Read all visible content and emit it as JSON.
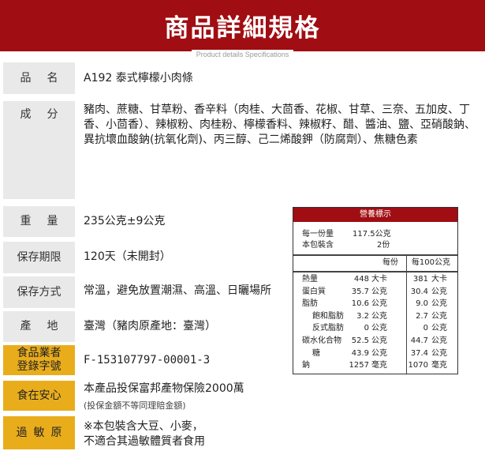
{
  "header": {
    "title": "商品詳細規格",
    "subtitle": "Product details Specifications"
  },
  "specs": {
    "name": {
      "label": "品名",
      "value": "A192 泰式檸檬小肉條"
    },
    "ingredients": {
      "label": "成分",
      "lines": [
        "豬肉、蔗糖、甘草粉、香辛料（肉桂、大茴香、花椒、甘草、三奈、五加皮、丁",
        "香、小茴香）、辣椒粉、肉桂粉、檸檬香料、辣椒籽、醋、醬油、鹽、亞硝酸鈉、",
        "異抗壞血酸鈉(抗氧化劑)、丙三醇、己二烯酸鉀（防腐劑）、焦糖色素"
      ]
    },
    "weight": {
      "label": "重量",
      "value": "235公克±9公克"
    },
    "shelf_life": {
      "label": "保存期限",
      "value": "120天（未開封）"
    },
    "storage": {
      "label": "保存方式",
      "value": "常溫，避免放置潮濕、高溫、日曬場所"
    },
    "origin": {
      "label": "產地",
      "value": "臺灣（豬肉原產地：臺灣）"
    },
    "registration": {
      "label_line1": "食品業者",
      "label_line2": "登錄字號",
      "value": "F-153107797-00001-3"
    },
    "insurance": {
      "label": "食在安心",
      "value": "本產品投保富邦產物保險2000萬",
      "note": "(投保金額不等同理賠金額)"
    },
    "allergen": {
      "label": "過敏原",
      "line1": "※本包裝含大豆、小麥，",
      "line2": "不適合其過敏體質者食用"
    }
  },
  "nutrition": {
    "title": "營養標示",
    "serving_size_label": "每一份量",
    "serving_size_value": "117.5公克",
    "servings_label": "本包裝含",
    "servings_value": "2份",
    "col_per_serving": "每份",
    "col_per_100g": "每100公克",
    "rows": [
      {
        "name": "熱量",
        "a": "448",
        "au": "大卡",
        "b": "381",
        "bu": "大卡",
        "indent": false
      },
      {
        "name": "蛋白質",
        "a": "35.7",
        "au": "公克",
        "b": "30.4",
        "bu": "公克",
        "indent": false
      },
      {
        "name": "脂肪",
        "a": "10.6",
        "au": "公克",
        "b": "9.0",
        "bu": "公克",
        "indent": false
      },
      {
        "name": "飽和脂肪",
        "a": "3.2",
        "au": "公克",
        "b": "2.7",
        "bu": "公克",
        "indent": true
      },
      {
        "name": "反式脂肪",
        "a": "0",
        "au": "公克",
        "b": "0",
        "bu": "公克",
        "indent": true
      },
      {
        "name": "碳水化合物",
        "a": "52.5",
        "au": "公克",
        "b": "44.7",
        "bu": "公克",
        "indent": false
      },
      {
        "name": "糖",
        "a": "43.9",
        "au": "公克",
        "b": "37.4",
        "bu": "公克",
        "indent": true
      },
      {
        "name": "鈉",
        "a": "1257",
        "au": "毫克",
        "b": "1070",
        "bu": "毫克",
        "indent": false
      }
    ]
  },
  "colors": {
    "brand_red": "#a00d12",
    "label_gray": "#e9e9e9",
    "label_gold": "#e9ad1c"
  }
}
